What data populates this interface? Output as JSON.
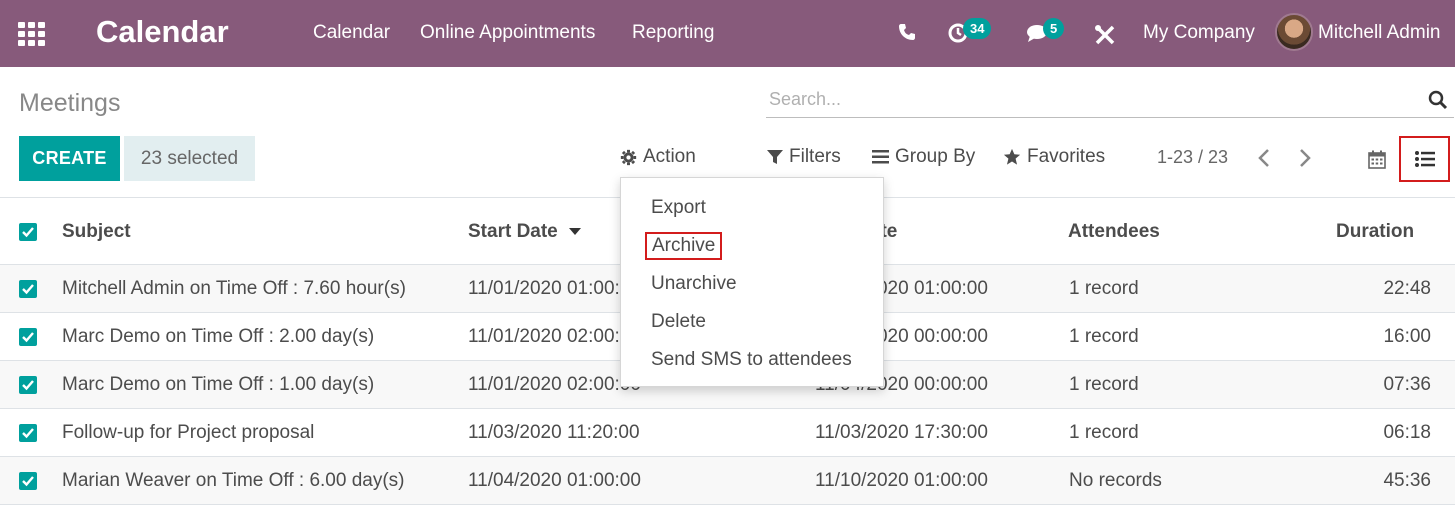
{
  "navbar": {
    "app_title": "Calendar",
    "menu": [
      "Calendar",
      "Online Appointments",
      "Reporting"
    ],
    "activity_count": "34",
    "message_count": "5",
    "company": "My Company",
    "user": "Mitchell Admin",
    "icons": [
      "apps-grid-icon",
      "phone-icon",
      "clock-icon",
      "chat-icon",
      "tools-icon"
    ]
  },
  "control": {
    "title": "Meetings",
    "search_placeholder": "Search...",
    "create_label": "CREATE",
    "selected_label": "23 selected",
    "action_label": "Action",
    "filters_label": "Filters",
    "groupby_label": "Group By",
    "favorites_label": "Favorites",
    "pager": "1-23 / 23"
  },
  "action_menu": {
    "items": [
      "Export",
      "Archive",
      "Unarchive",
      "Delete",
      "Send SMS to attendees"
    ]
  },
  "table": {
    "headers": {
      "subject": "Subject",
      "start": "Start Date",
      "end": "End Date",
      "attendees": "Attendees",
      "duration": "Duration"
    },
    "rows": [
      {
        "subject": "Mitchell Admin on Time Off : 7.60 hour(s)",
        "start": "11/01/2020 01:00:00",
        "end": "11/02/2020 01:00:00",
        "attendees": "1 record",
        "duration": "22:48"
      },
      {
        "subject": "Marc Demo on Time Off : 2.00 day(s)",
        "start": "11/01/2020 02:00:00",
        "end": "11/03/2020 00:00:00",
        "attendees": "1 record",
        "duration": "16:00"
      },
      {
        "subject": "Marc Demo on Time Off : 1.00 day(s)",
        "start": "11/01/2020 02:00:00",
        "end": "11/04/2020 00:00:00",
        "attendees": "1 record",
        "duration": "07:36"
      },
      {
        "subject": "Follow-up for Project proposal",
        "start": "11/03/2020 11:20:00",
        "end": "11/03/2020 17:30:00",
        "attendees": "1 record",
        "duration": "06:18"
      },
      {
        "subject": "Marian Weaver on Time Off : 6.00 day(s)",
        "start": "11/04/2020 01:00:00",
        "end": "11/10/2020 01:00:00",
        "attendees": "No records",
        "duration": "45:36"
      }
    ]
  },
  "colors": {
    "navbar": "#875a7b",
    "primary": "#00a09d",
    "highlight_border": "#d31c1c"
  }
}
